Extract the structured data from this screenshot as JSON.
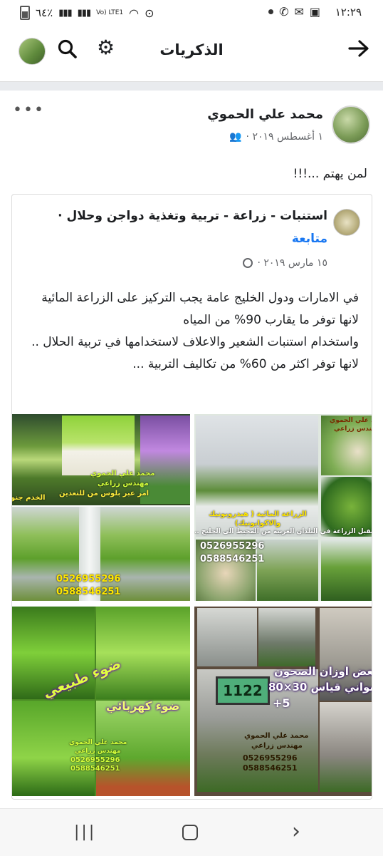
{
  "status_bar": {
    "time": "١٢:٢٩",
    "battery": "٦٤٪",
    "network": "Vo) LTE1",
    "icons": [
      "battery-icon",
      "signal-icon",
      "signal-icon",
      "lte-icon",
      "wifi-icon",
      "data-saver-icon",
      "dot-icon",
      "whatsapp-icon",
      "gmail-icon",
      "gallery-icon"
    ]
  },
  "header": {
    "title": "الذكريات",
    "back_icon": "arrow-right-icon",
    "search_icon": "search-icon",
    "settings_icon": "gear-icon"
  },
  "post": {
    "author": "محمد علي الحموي",
    "date": "١ أغسطس ٢٠١٩ ·",
    "audience_icon": "friends-icon",
    "more_icon": "more-icon",
    "text": "لمن يهتم ...!!!"
  },
  "shared_post": {
    "page_name": "استنبات - زراعة - تربية وتغذية دواجن وحلال ·",
    "follow_label": "متابعة",
    "date": "١٥ مارس ٢٠١٩ ·",
    "audience_icon": "globe-icon",
    "body": [
      "في الامارات ودول الخليج عامة يجب التركيز على الزراعة المائية لانها توفر ما يقارب 90% من المياه",
      "واستخدام استنبات الشعير والاعلاف لاستخدامها في تربية الحلال ..",
      "لانها توفر اكثر من 60% من تكاليف التربية ..."
    ]
  },
  "images": {
    "img1": {
      "caption_top": "محمد علي الحموي",
      "caption_bottom": "مهندس زراعي",
      "side_text": "امر عبر بلوس من للتعدين",
      "corner_text": "الخدم جنوب"
    },
    "img2": {
      "caption_top": "محمد علي الحموي",
      "caption_sub": "مهندس زراعي",
      "hydro_title": "الزراعة المائية ( هيدروبونيك والاكوابونيك)",
      "future_text": "مستقبل الزراعة في البلدان العربية من المحيط الى الخليج ..",
      "phones": [
        "0526955296",
        "0588546251"
      ]
    },
    "img3": {
      "phones": [
        "0526955296",
        "0588546251"
      ]
    },
    "img4": {
      "natural_light": "ضوء طبيعي",
      "electric_light": "ضوء كهربائي",
      "caption_name": "محمد علي الحموي",
      "caption_title": "مهندس زراعي",
      "phones": [
        "0526955296",
        "0588546251"
      ]
    },
    "img5": {
      "weights_title": "بعض اوزان الصحون",
      "weights_sub": "لصواني قياس 30×80",
      "plus": "+5",
      "scale_reading": "1122",
      "caption_name": "محمد علي الحموي",
      "caption_title": "مهندس زراعي",
      "phones": [
        "0526955296",
        "0588546251"
      ]
    }
  },
  "nav": {
    "recent_icon": "recent-apps-icon",
    "home_icon": "home-icon",
    "back_icon": "back-chevron-icon"
  }
}
